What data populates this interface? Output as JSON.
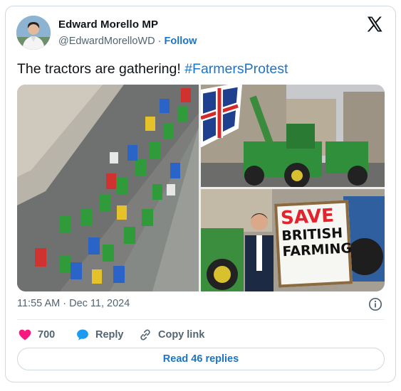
{
  "author": {
    "name": "Edward Morello MP",
    "handle": "@EdwardMorelloWD",
    "separator": " · ",
    "follow_label": "Follow"
  },
  "tweet": {
    "text": "The tractors are gathering! ",
    "hashtag": "#FarmersProtest"
  },
  "media": {
    "sign_lines": [
      "SAVE",
      "BRITISH",
      "FARMING"
    ]
  },
  "meta": {
    "time": "11:55 AM",
    "separator": " · ",
    "date": "Dec 11, 2024"
  },
  "actions": {
    "like_count": "700",
    "reply_label": "Reply",
    "copy_label": "Copy link"
  },
  "read_replies_label": "Read 46 replies",
  "colors": {
    "link": "#1d74c4",
    "like": "#f91880",
    "reply": "#1d9bf0",
    "text_secondary": "#536471",
    "border": "#cfd9de"
  },
  "icons": [
    "x-logo-icon",
    "heart-icon",
    "reply-bubble-icon",
    "link-icon",
    "info-icon"
  ]
}
